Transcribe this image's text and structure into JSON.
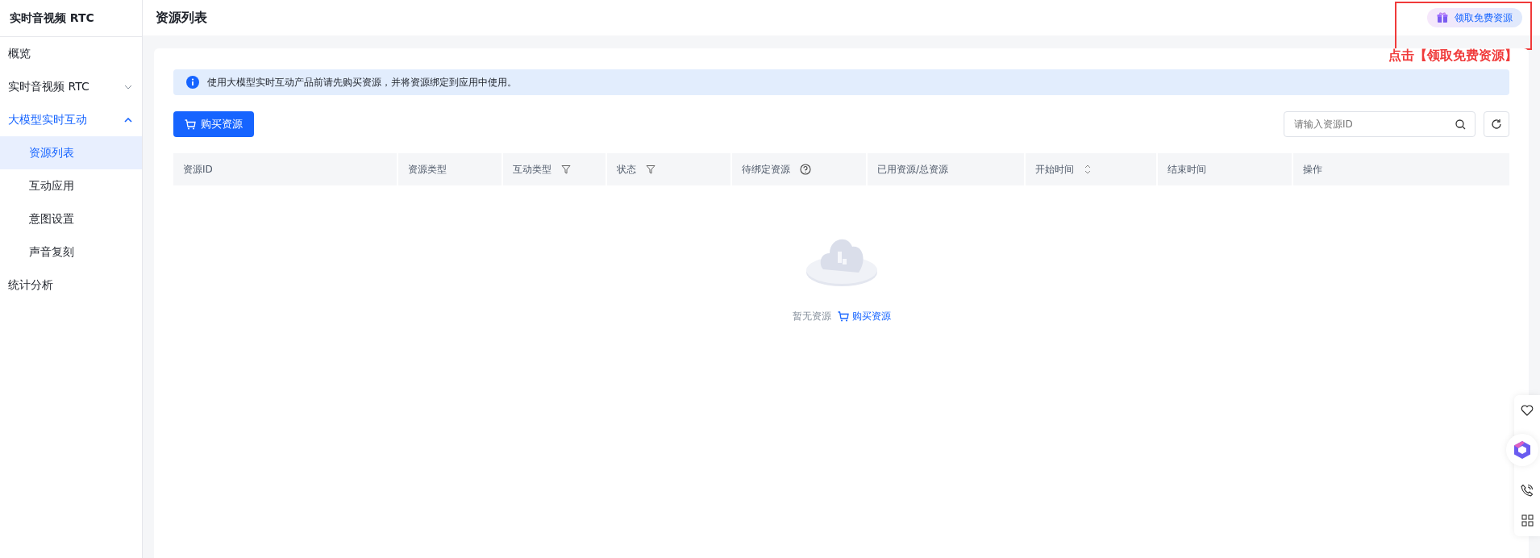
{
  "sidebar": {
    "title": "实时音视频 RTC",
    "items": [
      {
        "label": "概览",
        "selected": false
      },
      {
        "label": "实时音视频 RTC",
        "selected": false,
        "expanded": false
      },
      {
        "label": "大模型实时互动",
        "selected": false,
        "expanded": true,
        "children": [
          {
            "label": "资源列表",
            "selected": true
          },
          {
            "label": "互动应用",
            "selected": false
          },
          {
            "label": "意图设置",
            "selected": false
          },
          {
            "label": "声音复刻",
            "selected": false
          }
        ]
      },
      {
        "label": "统计分析",
        "selected": false
      }
    ]
  },
  "header": {
    "title": "资源列表",
    "promo_button": "领取免费资源"
  },
  "annotation": {
    "text": "点击【领取免费资源】"
  },
  "notice": "使用大模型实时互动产品前请先购买资源，并将资源绑定到应用中使用。",
  "buy_button": "购买资源",
  "search": {
    "placeholder": "请输入资源ID"
  },
  "table": {
    "columns": [
      {
        "label": "资源ID",
        "kind": "plain"
      },
      {
        "label": "资源类型",
        "kind": "plain"
      },
      {
        "label": "互动类型",
        "kind": "filter"
      },
      {
        "label": "状态",
        "kind": "filter"
      },
      {
        "label": "待绑定资源",
        "kind": "help"
      },
      {
        "label": "已用资源/总资源",
        "kind": "plain"
      },
      {
        "label": "开始时间",
        "kind": "sort"
      },
      {
        "label": "结束时间",
        "kind": "plain"
      },
      {
        "label": "操作",
        "kind": "plain"
      }
    ]
  },
  "empty": {
    "text": "暂无资源",
    "link": "购买资源"
  }
}
